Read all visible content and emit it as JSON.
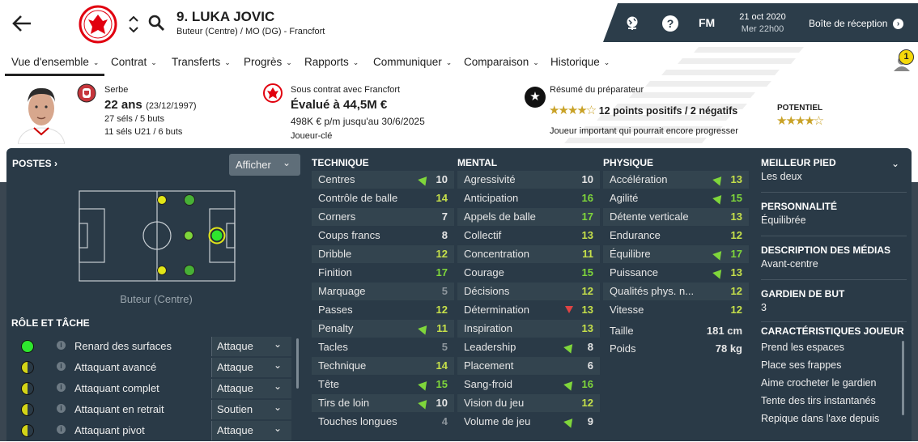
{
  "player": {
    "name": "9. LUKA JOVIC",
    "positions": "Buteur (Centre) / MO (DG) - Francfort"
  },
  "topbar": {
    "fm_label": "FM",
    "date": "21 oct 2020",
    "time": "Mer 22h00",
    "inbox": "Boîte de réception"
  },
  "tabs": [
    "Vue d'ensemble",
    "Contrat",
    "Transferts",
    "Progrès",
    "Rapports",
    "Communiquer",
    "Comparaison",
    "Historique"
  ],
  "notification_count": "1",
  "summary": {
    "nationality": "Serbe",
    "age": "22 ans",
    "dob": "(23/12/1997)",
    "caps": "27 séls / 5 buts",
    "caps_u21": "11 séls U21 / 6 buts",
    "contract_with": "Sous contrat avec Francfort",
    "value": "Évalué à 44,5M €",
    "wage": "498K € p/m jusqu'au 30/6/2025",
    "squad_status": "Joueur-clé",
    "coach_report_title": "Résumé du préparateur",
    "coach_points": "12 points positifs / 2 négatifs",
    "coach_summary": "Joueur important qui pourrait encore progresser",
    "potential_label": "POTENTIEL"
  },
  "positions_panel": {
    "title": "POSTES",
    "show_button": "Afficher",
    "position_label": "Buteur (Centre)"
  },
  "roles": {
    "title": "RÔLE ET TÂCHE",
    "items": [
      {
        "name": "Renard des surfaces",
        "duty": "Attaque",
        "level": "full"
      },
      {
        "name": "Attaquant avancé",
        "duty": "Attaque",
        "level": "half"
      },
      {
        "name": "Attaquant complet",
        "duty": "Attaque",
        "level": "half"
      },
      {
        "name": "Attaquant en retrait",
        "duty": "Soutien",
        "level": "half"
      },
      {
        "name": "Attaquant pivot",
        "duty": "Attaque",
        "level": "half"
      }
    ]
  },
  "technique": {
    "title": "TECHNIQUE",
    "rows": [
      {
        "name": "Centres",
        "value": "10",
        "trend": "up"
      },
      {
        "name": "Contrôle de balle",
        "value": "14",
        "trend": ""
      },
      {
        "name": "Corners",
        "value": "7",
        "trend": ""
      },
      {
        "name": "Coups francs",
        "value": "8",
        "trend": ""
      },
      {
        "name": "Dribble",
        "value": "12",
        "trend": ""
      },
      {
        "name": "Finition",
        "value": "17",
        "trend": ""
      },
      {
        "name": "Marquage",
        "value": "5",
        "trend": ""
      },
      {
        "name": "Passes",
        "value": "12",
        "trend": ""
      },
      {
        "name": "Penalty",
        "value": "11",
        "trend": "up"
      },
      {
        "name": "Tacles",
        "value": "5",
        "trend": ""
      },
      {
        "name": "Technique",
        "value": "14",
        "trend": ""
      },
      {
        "name": "Tête",
        "value": "15",
        "trend": "up"
      },
      {
        "name": "Tirs de loin",
        "value": "10",
        "trend": "up"
      },
      {
        "name": "Touches longues",
        "value": "4",
        "trend": ""
      }
    ]
  },
  "mental": {
    "title": "MENTAL",
    "rows": [
      {
        "name": "Agressivité",
        "value": "10",
        "trend": ""
      },
      {
        "name": "Anticipation",
        "value": "16",
        "trend": ""
      },
      {
        "name": "Appels de balle",
        "value": "17",
        "trend": ""
      },
      {
        "name": "Collectif",
        "value": "13",
        "trend": ""
      },
      {
        "name": "Concentration",
        "value": "11",
        "trend": ""
      },
      {
        "name": "Courage",
        "value": "15",
        "trend": ""
      },
      {
        "name": "Décisions",
        "value": "12",
        "trend": ""
      },
      {
        "name": "Détermination",
        "value": "13",
        "trend": "down"
      },
      {
        "name": "Inspiration",
        "value": "13",
        "trend": ""
      },
      {
        "name": "Leadership",
        "value": "8",
        "trend": "up"
      },
      {
        "name": "Placement",
        "value": "6",
        "trend": ""
      },
      {
        "name": "Sang-froid",
        "value": "16",
        "trend": "up"
      },
      {
        "name": "Vision du jeu",
        "value": "12",
        "trend": ""
      },
      {
        "name": "Volume de jeu",
        "value": "9",
        "trend": "up"
      }
    ]
  },
  "physique": {
    "title": "PHYSIQUE",
    "rows": [
      {
        "name": "Accélération",
        "value": "13",
        "trend": "up"
      },
      {
        "name": "Agilité",
        "value": "15",
        "trend": "up"
      },
      {
        "name": "Détente verticale",
        "value": "13",
        "trend": ""
      },
      {
        "name": "Endurance",
        "value": "12",
        "trend": ""
      },
      {
        "name": "Équilibre",
        "value": "17",
        "trend": "up"
      },
      {
        "name": "Puissance",
        "value": "13",
        "trend": "up"
      },
      {
        "name": "Qualités phys. n...",
        "value": "12",
        "trend": ""
      },
      {
        "name": "Vitesse",
        "value": "12",
        "trend": ""
      }
    ],
    "height_label": "Taille",
    "height": "181 cm",
    "weight_label": "Poids",
    "weight": "78 kg"
  },
  "side": {
    "best_foot_label": "MEILLEUR PIED",
    "best_foot": "Les deux",
    "personality_label": "PERSONNALITÉ",
    "personality": "Équilibrée",
    "media_label": "DESCRIPTION DES MÉDIAS",
    "media": "Avant-centre",
    "gk_label": "GARDIEN DE BUT",
    "gk": "3",
    "traits_label": "CARACTÉRISTIQUES JOUEUR",
    "traits": [
      "Prend les espaces",
      "Place ses frappes",
      "Aime crocheter le gardien",
      "Tente des tirs instantanés",
      "Repique dans l'axe depuis"
    ]
  },
  "colors": {
    "panel": "#2a3a47",
    "green": "#7fd63b",
    "red": "#e04444",
    "yellow": "#d4d417"
  }
}
